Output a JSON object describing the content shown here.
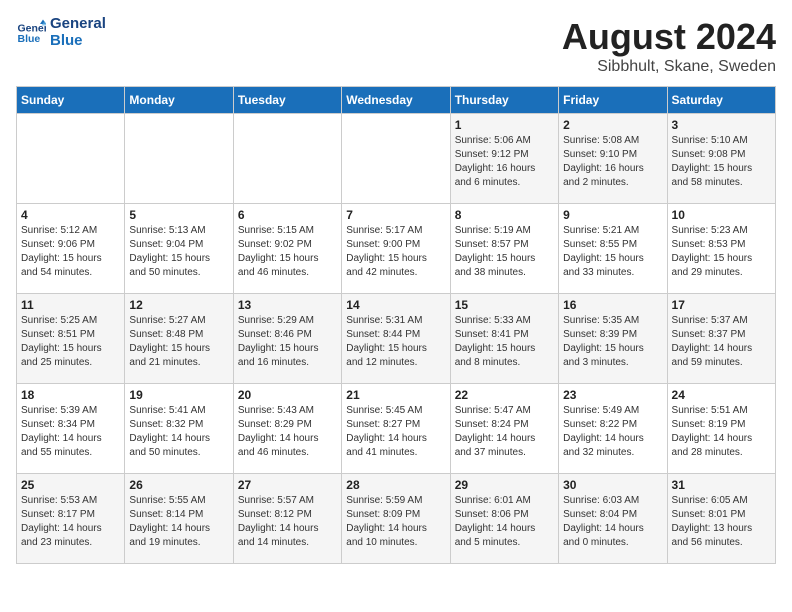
{
  "header": {
    "logo_line1": "General",
    "logo_line2": "Blue",
    "month_title": "August 2024",
    "subtitle": "Sibbhult, Skane, Sweden"
  },
  "weekdays": [
    "Sunday",
    "Monday",
    "Tuesday",
    "Wednesday",
    "Thursday",
    "Friday",
    "Saturday"
  ],
  "weeks": [
    [
      {
        "day": "",
        "info": ""
      },
      {
        "day": "",
        "info": ""
      },
      {
        "day": "",
        "info": ""
      },
      {
        "day": "",
        "info": ""
      },
      {
        "day": "1",
        "info": "Sunrise: 5:06 AM\nSunset: 9:12 PM\nDaylight: 16 hours\nand 6 minutes."
      },
      {
        "day": "2",
        "info": "Sunrise: 5:08 AM\nSunset: 9:10 PM\nDaylight: 16 hours\nand 2 minutes."
      },
      {
        "day": "3",
        "info": "Sunrise: 5:10 AM\nSunset: 9:08 PM\nDaylight: 15 hours\nand 58 minutes."
      }
    ],
    [
      {
        "day": "4",
        "info": "Sunrise: 5:12 AM\nSunset: 9:06 PM\nDaylight: 15 hours\nand 54 minutes."
      },
      {
        "day": "5",
        "info": "Sunrise: 5:13 AM\nSunset: 9:04 PM\nDaylight: 15 hours\nand 50 minutes."
      },
      {
        "day": "6",
        "info": "Sunrise: 5:15 AM\nSunset: 9:02 PM\nDaylight: 15 hours\nand 46 minutes."
      },
      {
        "day": "7",
        "info": "Sunrise: 5:17 AM\nSunset: 9:00 PM\nDaylight: 15 hours\nand 42 minutes."
      },
      {
        "day": "8",
        "info": "Sunrise: 5:19 AM\nSunset: 8:57 PM\nDaylight: 15 hours\nand 38 minutes."
      },
      {
        "day": "9",
        "info": "Sunrise: 5:21 AM\nSunset: 8:55 PM\nDaylight: 15 hours\nand 33 minutes."
      },
      {
        "day": "10",
        "info": "Sunrise: 5:23 AM\nSunset: 8:53 PM\nDaylight: 15 hours\nand 29 minutes."
      }
    ],
    [
      {
        "day": "11",
        "info": "Sunrise: 5:25 AM\nSunset: 8:51 PM\nDaylight: 15 hours\nand 25 minutes."
      },
      {
        "day": "12",
        "info": "Sunrise: 5:27 AM\nSunset: 8:48 PM\nDaylight: 15 hours\nand 21 minutes."
      },
      {
        "day": "13",
        "info": "Sunrise: 5:29 AM\nSunset: 8:46 PM\nDaylight: 15 hours\nand 16 minutes."
      },
      {
        "day": "14",
        "info": "Sunrise: 5:31 AM\nSunset: 8:44 PM\nDaylight: 15 hours\nand 12 minutes."
      },
      {
        "day": "15",
        "info": "Sunrise: 5:33 AM\nSunset: 8:41 PM\nDaylight: 15 hours\nand 8 minutes."
      },
      {
        "day": "16",
        "info": "Sunrise: 5:35 AM\nSunset: 8:39 PM\nDaylight: 15 hours\nand 3 minutes."
      },
      {
        "day": "17",
        "info": "Sunrise: 5:37 AM\nSunset: 8:37 PM\nDaylight: 14 hours\nand 59 minutes."
      }
    ],
    [
      {
        "day": "18",
        "info": "Sunrise: 5:39 AM\nSunset: 8:34 PM\nDaylight: 14 hours\nand 55 minutes."
      },
      {
        "day": "19",
        "info": "Sunrise: 5:41 AM\nSunset: 8:32 PM\nDaylight: 14 hours\nand 50 minutes."
      },
      {
        "day": "20",
        "info": "Sunrise: 5:43 AM\nSunset: 8:29 PM\nDaylight: 14 hours\nand 46 minutes."
      },
      {
        "day": "21",
        "info": "Sunrise: 5:45 AM\nSunset: 8:27 PM\nDaylight: 14 hours\nand 41 minutes."
      },
      {
        "day": "22",
        "info": "Sunrise: 5:47 AM\nSunset: 8:24 PM\nDaylight: 14 hours\nand 37 minutes."
      },
      {
        "day": "23",
        "info": "Sunrise: 5:49 AM\nSunset: 8:22 PM\nDaylight: 14 hours\nand 32 minutes."
      },
      {
        "day": "24",
        "info": "Sunrise: 5:51 AM\nSunset: 8:19 PM\nDaylight: 14 hours\nand 28 minutes."
      }
    ],
    [
      {
        "day": "25",
        "info": "Sunrise: 5:53 AM\nSunset: 8:17 PM\nDaylight: 14 hours\nand 23 minutes."
      },
      {
        "day": "26",
        "info": "Sunrise: 5:55 AM\nSunset: 8:14 PM\nDaylight: 14 hours\nand 19 minutes."
      },
      {
        "day": "27",
        "info": "Sunrise: 5:57 AM\nSunset: 8:12 PM\nDaylight: 14 hours\nand 14 minutes."
      },
      {
        "day": "28",
        "info": "Sunrise: 5:59 AM\nSunset: 8:09 PM\nDaylight: 14 hours\nand 10 minutes."
      },
      {
        "day": "29",
        "info": "Sunrise: 6:01 AM\nSunset: 8:06 PM\nDaylight: 14 hours\nand 5 minutes."
      },
      {
        "day": "30",
        "info": "Sunrise: 6:03 AM\nSunset: 8:04 PM\nDaylight: 14 hours\nand 0 minutes."
      },
      {
        "day": "31",
        "info": "Sunrise: 6:05 AM\nSunset: 8:01 PM\nDaylight: 13 hours\nand 56 minutes."
      }
    ]
  ]
}
